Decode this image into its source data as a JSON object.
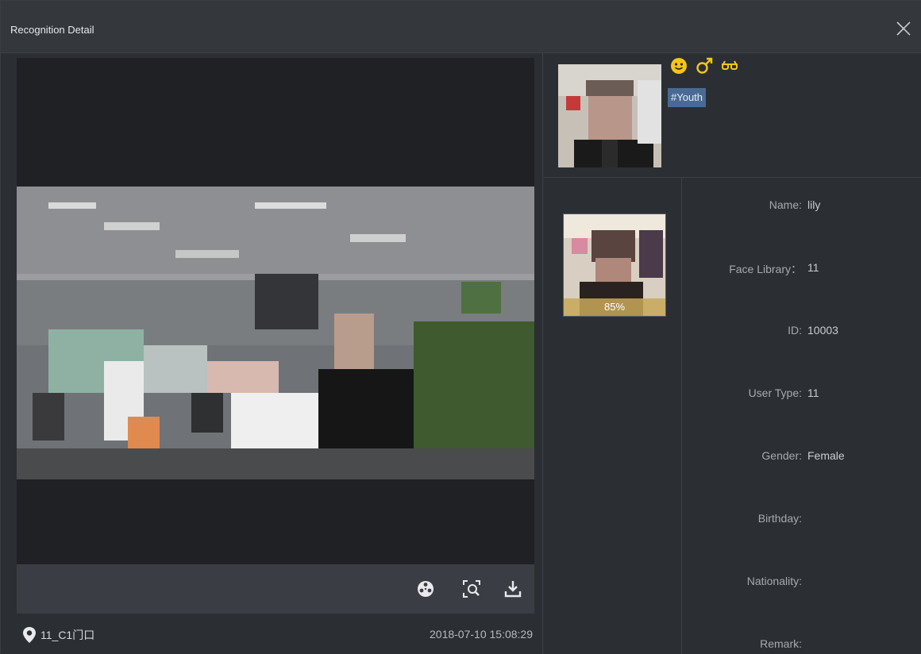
{
  "window": {
    "title": "Recognition Detail",
    "close_icon": "close-icon"
  },
  "video": {
    "toolbar": {
      "icons": [
        "film-reel-icon",
        "zoom-face-icon",
        "download-icon"
      ]
    },
    "location": {
      "icon": "location-pin-icon",
      "text": "11_C1门口"
    },
    "timestamp": "2018-07-10 15:08:29"
  },
  "capture": {
    "attribute_icons": [
      "smile-icon",
      "male-icon",
      "glasses-icon"
    ],
    "tag": "#Youth",
    "accent": "#f5c518",
    "tag_bg": "#4a6a95"
  },
  "match": {
    "similarity": "85%"
  },
  "person": {
    "name_label": "Name:",
    "name": "lily",
    "library_label": "Face Library：",
    "library": "11",
    "id_label": "ID:",
    "id": "10003",
    "usertype_label": "User Type:",
    "usertype": "11",
    "gender_label": "Gender:",
    "gender": "Female",
    "birthday_label": "Birthday:",
    "birthday": "",
    "nationality_label": "Nationality:",
    "nationality": "",
    "remark_label": "Remark:",
    "remark": ""
  }
}
